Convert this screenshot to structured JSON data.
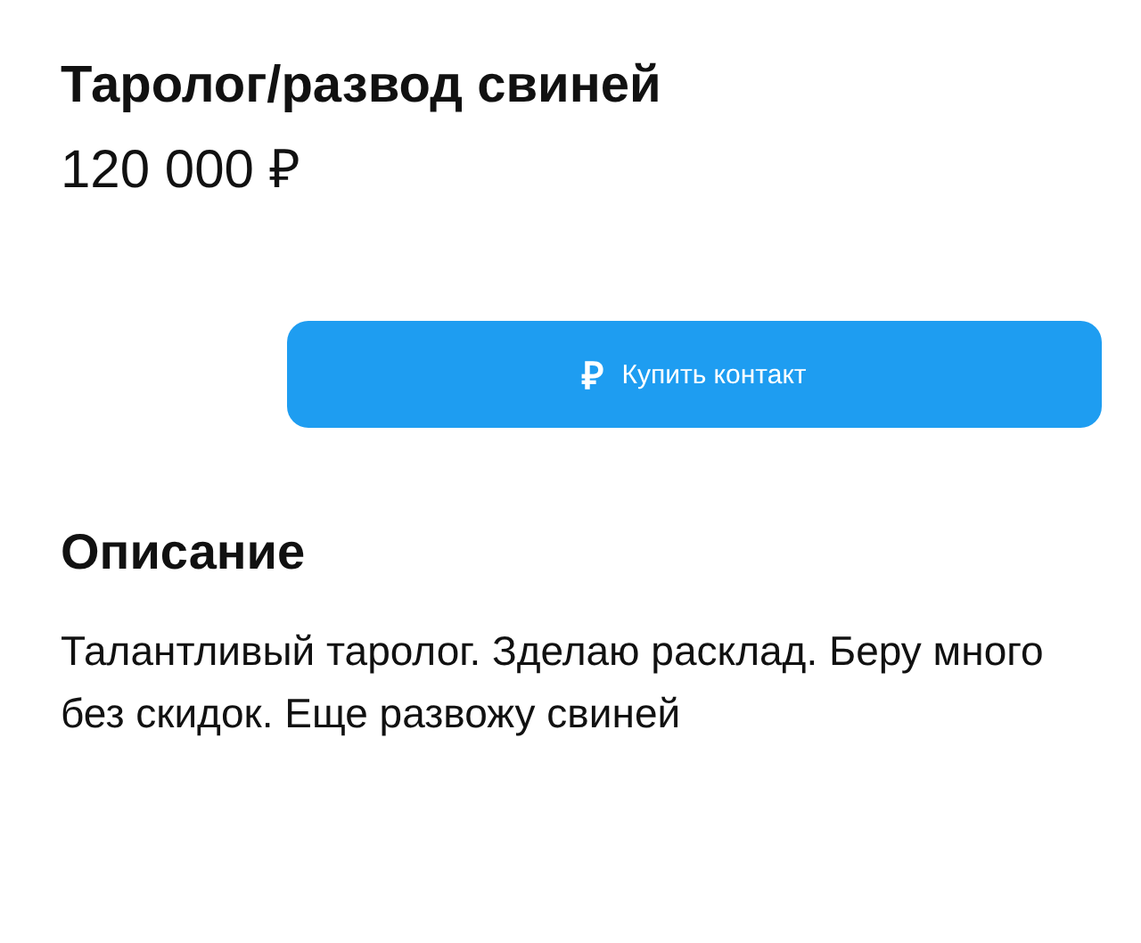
{
  "listing": {
    "title": "Таролог/развод свиней",
    "price": "120 000 ₽"
  },
  "buy_button": {
    "icon": "₽",
    "label": "Купить контакт"
  },
  "description": {
    "heading": "Описание",
    "text": "Талантливый таролог. Зделаю расклад. Беру много без скидок. Еще развожу свиней"
  }
}
